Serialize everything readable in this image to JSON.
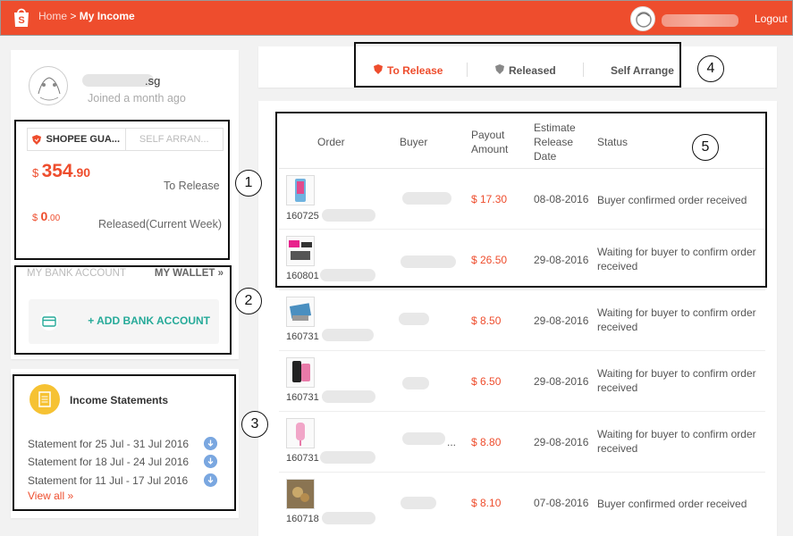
{
  "header": {
    "breadcrumb_home": "Home",
    "breadcrumb_sep": ">",
    "breadcrumb_current": "My Income",
    "logout": "Logout",
    "brand_color": "#ee4d2d"
  },
  "profile": {
    "username_suffix": ".sg",
    "joined": "Joined a month ago"
  },
  "balance_tabs": {
    "active": "SHOPEE GUA...",
    "inactive": "SELF ARRAN..."
  },
  "balances": {
    "to_release": {
      "currency": "$",
      "int": "354",
      "dec": ".90",
      "label": "To Release"
    },
    "released": {
      "currency": "$",
      "int": "0",
      "dec": ".00",
      "label": "Released(Current Week)"
    }
  },
  "bank": {
    "my_bank_account": "MY BANK ACCOUNT",
    "my_wallet": "MY WALLET »",
    "add_bank_account": "+ ADD BANK ACCOUNT"
  },
  "statements": {
    "title": "Income Statements",
    "items": [
      "Statement for 25 Jul - 31 Jul 2016",
      "Statement for 18 Jul - 24 Jul 2016",
      "Statement for 11 Jul - 17 Jul 2016"
    ],
    "view_all": "View all »"
  },
  "release_tabs": {
    "to_release": "To Release",
    "released": "Released",
    "self_arrange": "Self Arrange"
  },
  "table": {
    "headers": {
      "order": "Order",
      "buyer": "Buyer",
      "payout": "Payout Amount",
      "estimate": "Estimate Release Date",
      "status": "Status"
    },
    "rows": [
      {
        "order": "160725",
        "payout": "$ 17.30",
        "date": "08-08-2016",
        "status": "Buyer confirmed order received"
      },
      {
        "order": "160801",
        "payout": "$ 26.50",
        "date": "29-08-2016",
        "status": "Waiting for buyer to confirm order received"
      },
      {
        "order": "160731",
        "payout": "$ 8.50",
        "date": "29-08-2016",
        "status": "Waiting for buyer to confirm order received"
      },
      {
        "order": "160731",
        "payout": "$ 6.50",
        "date": "29-08-2016",
        "status": "Waiting for buyer to confirm order received"
      },
      {
        "order": "160731",
        "payout": "$ 8.80",
        "date": "29-08-2016",
        "status": "Waiting for buyer to confirm order received"
      },
      {
        "order": "160718",
        "payout": "$ 8.10",
        "date": "07-08-2016",
        "status": "Buyer confirmed order received"
      }
    ],
    "buyer_ellipsis": "..."
  },
  "annotations": [
    "1",
    "2",
    "3",
    "4",
    "5"
  ]
}
